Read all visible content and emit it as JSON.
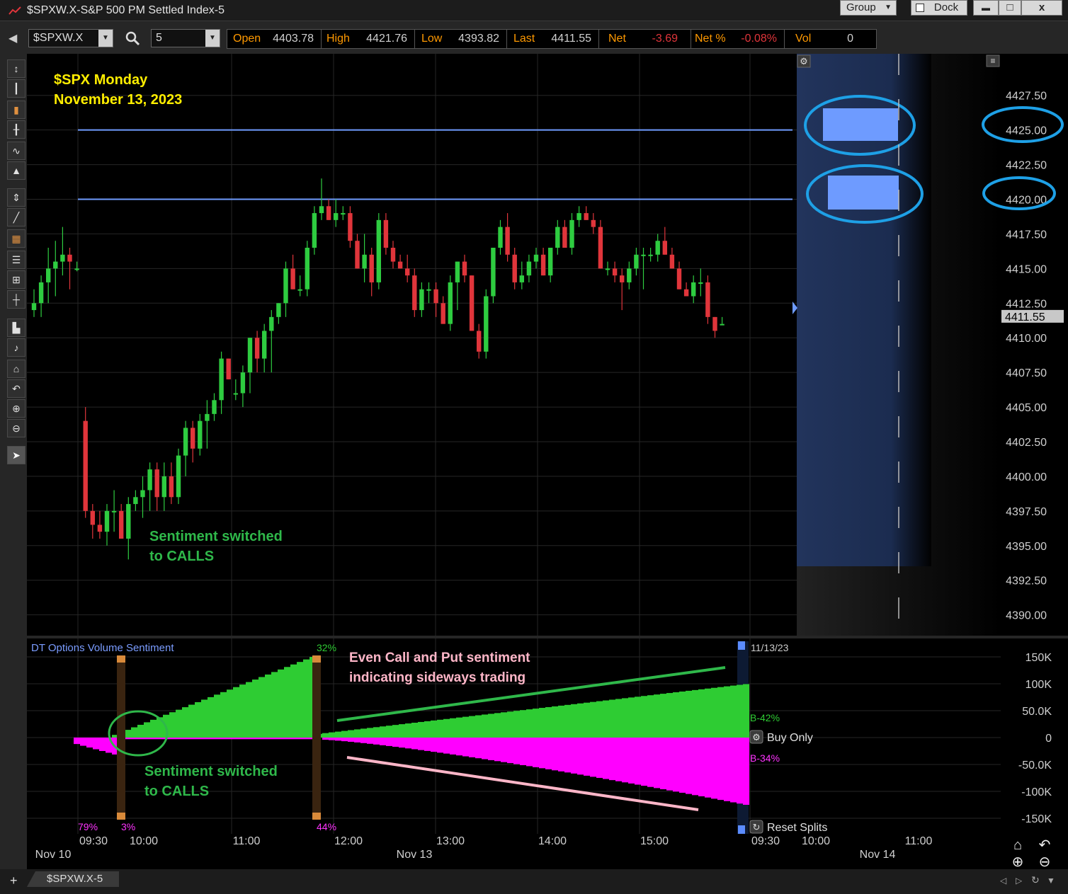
{
  "window": {
    "title": "$SPXW.X-S&P 500 PM Settled Index-5",
    "group_label": "Group",
    "dock_label": "Dock",
    "min_glyph": "▬",
    "max_glyph": "□",
    "close_glyph": "x"
  },
  "toolbar": {
    "symbol": "$SPXW.X",
    "interval": "5"
  },
  "quote": {
    "open_label": "Open",
    "open": "4403.78",
    "high_label": "High",
    "high": "4421.76",
    "low_label": "Low",
    "low": "4393.82",
    "last_label": "Last",
    "last": "4411.55",
    "net_label": "Net",
    "net": "-3.69",
    "netpct_label": "Net %",
    "netpct": "-0.08%",
    "vol_label": "Vol",
    "vol": "0"
  },
  "colors": {
    "up": "#2ecc40",
    "down": "#e0353b",
    "level_line": "#6f9cff",
    "highlight_circle": "#1ea0e6",
    "annotation_yellow": "#ffee00",
    "annotation_green": "#2fb84a",
    "annotation_pink": "#ffb6c8",
    "sentiment_call": "#2ecc33",
    "sentiment_put": "#ff00ff"
  },
  "annotations": {
    "title_line1": "$SPX Monday",
    "title_line2": "November 13, 2023",
    "price_note_line1": "Sentiment switched",
    "price_note_line2": "to CALLS",
    "sent_note_line1": "Sentiment switched",
    "sent_note_line2": "to CALLS",
    "even_line1": "Even Call and Put sentiment",
    "even_line2": "indicating sideways trading"
  },
  "sentiment": {
    "title": "DT Options Volume Sentiment",
    "date": "11/13/23",
    "pct_top": "32%",
    "pct_a": "79%",
    "pct_b": "3%",
    "pct_c": "44%",
    "buy_label": "B-42%",
    "sell_label": "B-34%",
    "buy_only": "Buy Only",
    "reset_splits": "Reset Splits",
    "axis": [
      "150K",
      "100K",
      "50.0K",
      "0",
      "-50.0K",
      "-100K",
      "-150K"
    ]
  },
  "time_axis": {
    "times": [
      "09:30",
      "10:00",
      "11:00",
      "12:00",
      "13:00",
      "14:00",
      "15:00",
      "09:30",
      "10:00",
      "11:00"
    ],
    "dates": [
      "Nov 10",
      "Nov 13",
      "Nov 14"
    ]
  },
  "tab": {
    "label": "$SPXW.X-5"
  },
  "chart_data": {
    "type": "candlestick",
    "price_axis": [
      "4427.50",
      "4425.00",
      "4422.50",
      "4420.00",
      "4417.50",
      "4415.00",
      "4412.50",
      "4410.00",
      "4407.50",
      "4405.00",
      "4402.50",
      "4400.00",
      "4397.50",
      "4395.00",
      "4392.50",
      "4390.00"
    ],
    "last_price_label": "4411.55",
    "ylim": [
      4388.5,
      4430.5
    ],
    "levels": [
      4425.0,
      4420.0
    ],
    "candles": [
      [
        4412.0,
        4413.5,
        4411.5,
        4412.5
      ],
      [
        4412.5,
        4414.5,
        4411.5,
        4414.0
      ],
      [
        4414.0,
        4416.5,
        4412.5,
        4415.0
      ],
      [
        4415.0,
        4417.0,
        4413.0,
        4415.5
      ],
      [
        4415.5,
        4418.0,
        4414.5,
        4416.0
      ],
      [
        4416.0,
        4416.5,
        4413.5,
        4415.5
      ],
      [
        4415.0,
        4415.5,
        4414.8,
        4415.0
      ],
      [
        4404.0,
        4405.0,
        4397.0,
        4397.5
      ],
      [
        4397.5,
        4398.0,
        4395.5,
        4396.5
      ],
      [
        4396.5,
        4397.5,
        4395.5,
        4396.0
      ],
      [
        4396.0,
        4398.0,
        4395.0,
        4397.5
      ],
      [
        4397.5,
        4399.0,
        4396.0,
        4397.5
      ],
      [
        4397.5,
        4398.0,
        4395.5,
        4395.5
      ],
      [
        4395.5,
        4398.5,
        4394.0,
        4398.0
      ],
      [
        4398.0,
        4399.0,
        4397.5,
        4398.5
      ],
      [
        4398.5,
        4400.0,
        4397.0,
        4399.0
      ],
      [
        4399.0,
        4401.0,
        4397.5,
        4400.5
      ],
      [
        4400.5,
        4401.0,
        4397.5,
        4398.5
      ],
      [
        4398.5,
        4401.0,
        4397.5,
        4400.0
      ],
      [
        4400.0,
        4401.0,
        4398.0,
        4398.5
      ],
      [
        4398.5,
        4402.0,
        4398.0,
        4401.5
      ],
      [
        4401.5,
        4404.0,
        4400.0,
        4403.5
      ],
      [
        4403.5,
        4404.0,
        4401.0,
        4402.0
      ],
      [
        4402.0,
        4404.5,
        4401.5,
        4404.0
      ],
      [
        4404.0,
        4405.5,
        4402.0,
        4404.5
      ],
      [
        4404.5,
        4406.0,
        4404.0,
        4405.5
      ],
      [
        4405.5,
        4409.0,
        4404.5,
        4408.5
      ],
      [
        4408.5,
        4408.5,
        4407.0,
        4407.0
      ],
      [
        4406.0,
        4407.0,
        4405.5,
        4406.0
      ],
      [
        4406.0,
        4408.0,
        4405.0,
        4407.5
      ],
      [
        4407.5,
        4410.0,
        4406.0,
        4410.0
      ],
      [
        4410.0,
        4410.5,
        4407.5,
        4408.5
      ],
      [
        4408.5,
        4411.0,
        4407.5,
        4410.5
      ],
      [
        4410.5,
        4412.0,
        4407.5,
        4411.5
      ],
      [
        4411.5,
        4412.5,
        4411.0,
        4412.5
      ],
      [
        4412.5,
        4415.5,
        4411.5,
        4415.0
      ],
      [
        4415.0,
        4416.0,
        4413.5,
        4413.5
      ],
      [
        4413.5,
        4414.5,
        4413.0,
        4413.5
      ],
      [
        4413.5,
        4417.0,
        4413.0,
        4416.5
      ],
      [
        4416.5,
        4419.5,
        4416.0,
        4419.0
      ],
      [
        4419.0,
        4421.5,
        4418.5,
        4419.5
      ],
      [
        4419.5,
        4420.0,
        4418.5,
        4418.5
      ],
      [
        4418.5,
        4420.0,
        4418.0,
        4419.0
      ],
      [
        4419.0,
        4419.5,
        4418.5,
        4419.0
      ],
      [
        4419.0,
        4419.5,
        4416.5,
        4417.0
      ],
      [
        4417.0,
        4417.5,
        4415.0,
        4415.0
      ],
      [
        4415.0,
        4417.5,
        4414.0,
        4416.0
      ],
      [
        4416.0,
        4416.5,
        4413.0,
        4414.0
      ],
      [
        4414.0,
        4419.0,
        4413.5,
        4418.5
      ],
      [
        4418.5,
        4419.0,
        4416.0,
        4416.5
      ],
      [
        4416.5,
        4417.0,
        4415.0,
        4415.5
      ],
      [
        4415.5,
        4416.0,
        4415.0,
        4415.0
      ],
      [
        4415.0,
        4416.0,
        4414.0,
        4414.5
      ],
      [
        4414.5,
        4415.0,
        4411.5,
        4412.0
      ],
      [
        4412.0,
        4414.0,
        4411.5,
        4413.5
      ],
      [
        4413.5,
        4414.0,
        4412.5,
        4413.5
      ],
      [
        4413.5,
        4414.0,
        4411.5,
        4412.5
      ],
      [
        4412.5,
        4413.0,
        4411.0,
        4411.0
      ],
      [
        4411.0,
        4414.5,
        4410.5,
        4414.0
      ],
      [
        4414.0,
        4415.5,
        4412.0,
        4415.5
      ],
      [
        4415.5,
        4416.0,
        4414.0,
        4414.5
      ],
      [
        4414.5,
        4414.5,
        4410.5,
        4410.5
      ],
      [
        4410.5,
        4411.0,
        4408.5,
        4409.0
      ],
      [
        4409.0,
        4413.5,
        4408.5,
        4413.0
      ],
      [
        4413.0,
        4416.5,
        4412.5,
        4416.5
      ],
      [
        4416.5,
        4418.5,
        4416.0,
        4418.0
      ],
      [
        4418.0,
        4419.0,
        4415.5,
        4416.0
      ],
      [
        4416.0,
        4416.5,
        4413.5,
        4414.0
      ],
      [
        4414.0,
        4415.5,
        4413.5,
        4414.5
      ],
      [
        4414.5,
        4416.0,
        4414.0,
        4415.5
      ],
      [
        4415.5,
        4416.5,
        4415.0,
        4416.0
      ],
      [
        4416.0,
        4416.5,
        4414.5,
        4414.5
      ],
      [
        4414.5,
        4416.5,
        4414.0,
        4416.5
      ],
      [
        4416.5,
        4418.5,
        4416.0,
        4418.0
      ],
      [
        4418.0,
        4418.5,
        4416.5,
        4416.5
      ],
      [
        4416.5,
        4419.0,
        4416.0,
        4418.5
      ],
      [
        4418.5,
        4419.5,
        4418.0,
        4419.0
      ],
      [
        4419.0,
        4419.5,
        4418.5,
        4418.5
      ],
      [
        4418.5,
        4419.0,
        4417.5,
        4418.0
      ],
      [
        4418.0,
        4418.5,
        4415.0,
        4415.0
      ],
      [
        4415.0,
        4415.5,
        4414.5,
        4415.0
      ],
      [
        4415.0,
        4415.5,
        4414.0,
        4414.5
      ],
      [
        4414.5,
        4415.0,
        4412.0,
        4414.0
      ],
      [
        4414.0,
        4415.5,
        4413.5,
        4415.0
      ],
      [
        4415.0,
        4416.5,
        4414.5,
        4416.0
      ],
      [
        4416.0,
        4416.5,
        4413.5,
        4416.0
      ],
      [
        4416.0,
        4416.5,
        4415.5,
        4416.0
      ],
      [
        4416.0,
        4417.5,
        4415.5,
        4417.0
      ],
      [
        4417.0,
        4418.0,
        4416.0,
        4416.0
      ],
      [
        4416.0,
        4416.5,
        4415.0,
        4415.0
      ],
      [
        4415.0,
        4415.5,
        4413.5,
        4413.5
      ],
      [
        4413.5,
        4414.0,
        4413.0,
        4413.0
      ],
      [
        4413.0,
        4414.5,
        4412.5,
        4414.0
      ],
      [
        4414.0,
        4415.0,
        4413.0,
        4414.0
      ],
      [
        4414.0,
        4414.5,
        4411.0,
        4411.5
      ],
      [
        4411.5,
        4411.5,
        4410.0,
        4410.5
      ],
      [
        4411.0,
        4411.5,
        4411.0,
        4411.0
      ]
    ]
  }
}
